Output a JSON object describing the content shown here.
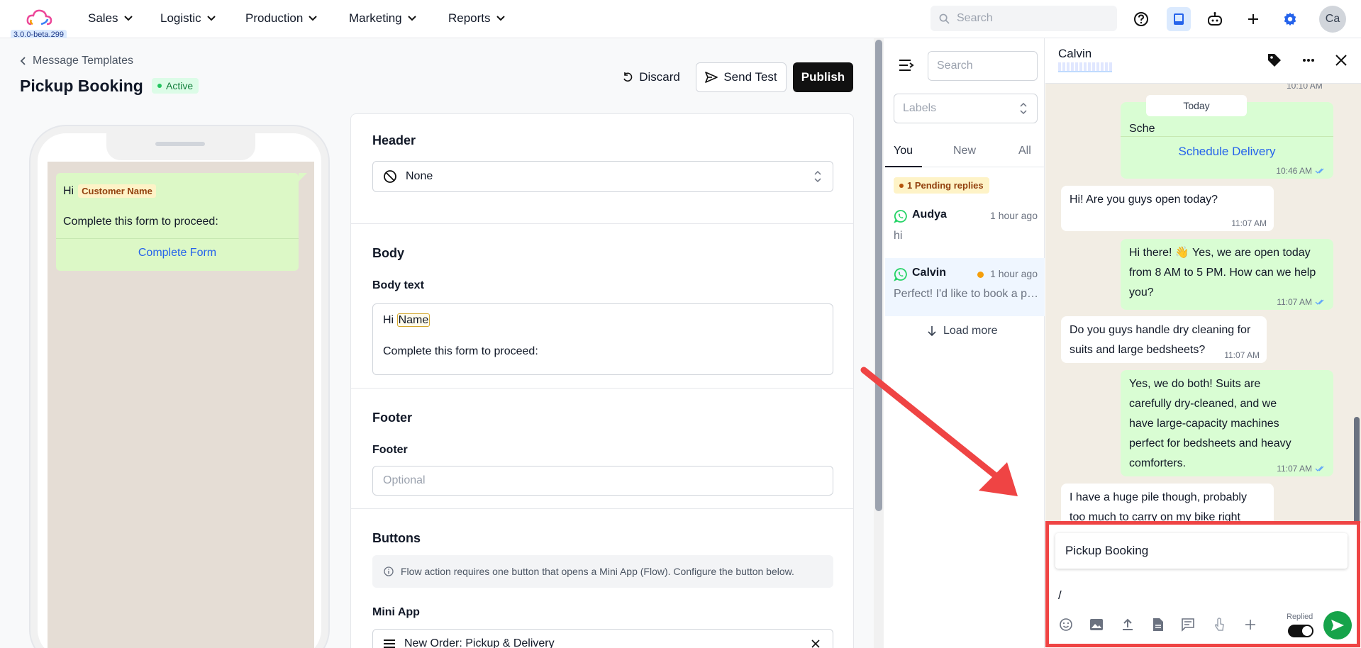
{
  "app": {
    "version": "3.0.0-beta.299"
  },
  "nav": {
    "items": [
      {
        "label": "Sales"
      },
      {
        "label": "Logistic"
      },
      {
        "label": "Production"
      },
      {
        "label": "Marketing"
      },
      {
        "label": "Reports"
      }
    ],
    "search_placeholder": "Search",
    "avatar_initials": "Ca"
  },
  "editor": {
    "back_label": "Message Templates",
    "title": "Pickup Booking",
    "status": "Active",
    "discard_label": "Discard",
    "send_test_label": "Send Test",
    "publish_label": "Publish"
  },
  "preview": {
    "greeting": "Hi",
    "variable": "Customer Name",
    "body": "Complete this form to proceed:",
    "button": "Complete Form"
  },
  "form": {
    "header_title": "Header",
    "header_value": "None",
    "body_title": "Body",
    "body_text_label": "Body text",
    "body_hi": "Hi",
    "body_var": "Name",
    "body_line2": "Complete this form to proceed:",
    "footer_title": "Footer",
    "footer_label": "Footer",
    "footer_placeholder": "Optional",
    "buttons_title": "Buttons",
    "buttons_info": "Flow action requires one button that opens a Mini App (Flow). Configure the button below.",
    "mini_app_label": "Mini App",
    "mini_app_value": "New Order: Pickup & Delivery"
  },
  "inbox": {
    "search_placeholder": "Search",
    "labels_placeholder": "Labels",
    "tabs": [
      {
        "label": "You"
      },
      {
        "label": "New"
      },
      {
        "label": "All"
      }
    ],
    "pending": "1 Pending replies",
    "conversations": [
      {
        "name": "Audya",
        "time": "1 hour ago",
        "preview": "hi"
      },
      {
        "name": "Calvin",
        "time": "1 hour ago",
        "preview": "Perfect! I'd like to book a pickup"
      }
    ],
    "load_more": "Load more"
  },
  "chat": {
    "contact": "Calvin",
    "top_time": "10:10 AM",
    "today": "Today",
    "sched_snippet": "Sche",
    "schedule_button": "Schedule Delivery",
    "schedule_time": "10:46 AM",
    "messages": [
      {
        "dir": "in",
        "text": "Hi! Are you guys open today?",
        "time": "11:07 AM"
      },
      {
        "dir": "out",
        "text": "Hi there! 👋 Yes, we are open today from 8 AM to 5 PM. How can we help you?",
        "time": "11:07 AM"
      },
      {
        "dir": "in",
        "text": "Do you guys handle dry cleaning for suits and large bedsheets?",
        "time": "11:07 AM"
      },
      {
        "dir": "out",
        "text": "Yes, we do both! Suits are carefully dry-cleaned, and we have large-capacity machines perfect for bedsheets and heavy comforters.",
        "time": "11:07 AM"
      },
      {
        "dir": "in",
        "text": "I have a huge pile though, probably too much to carry on my bike right",
        "time": ""
      }
    ],
    "suggestion": "Pickup Booking",
    "composer_text": "/",
    "replied_label": "Replied"
  },
  "colors": {
    "accent": "#2563eb",
    "whatsapp": "#25d366",
    "highlight": "#ef4444"
  }
}
